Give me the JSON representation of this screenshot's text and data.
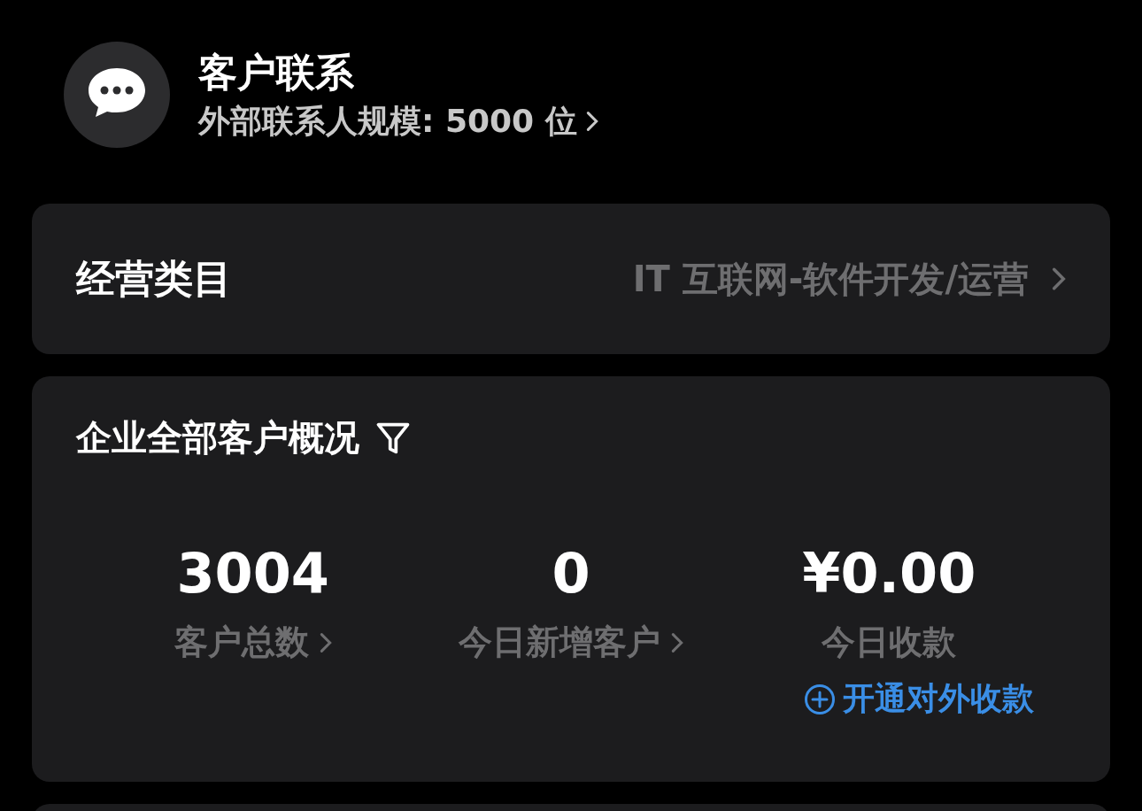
{
  "header": {
    "title": "客户联系",
    "subtitle": "外部联系人规模: 5000 位"
  },
  "category": {
    "label": "经营类目",
    "value": "IT 互联网-软件开发/运营"
  },
  "overview": {
    "title": "企业全部客户概况",
    "stats": [
      {
        "value": "3004",
        "label": "客户总数",
        "arrow": true
      },
      {
        "value": "0",
        "label": "今日新增客户",
        "arrow": true
      },
      {
        "value": "¥0.00",
        "label": "今日收款",
        "arrow": false
      }
    ],
    "action": "开通对外收款"
  }
}
